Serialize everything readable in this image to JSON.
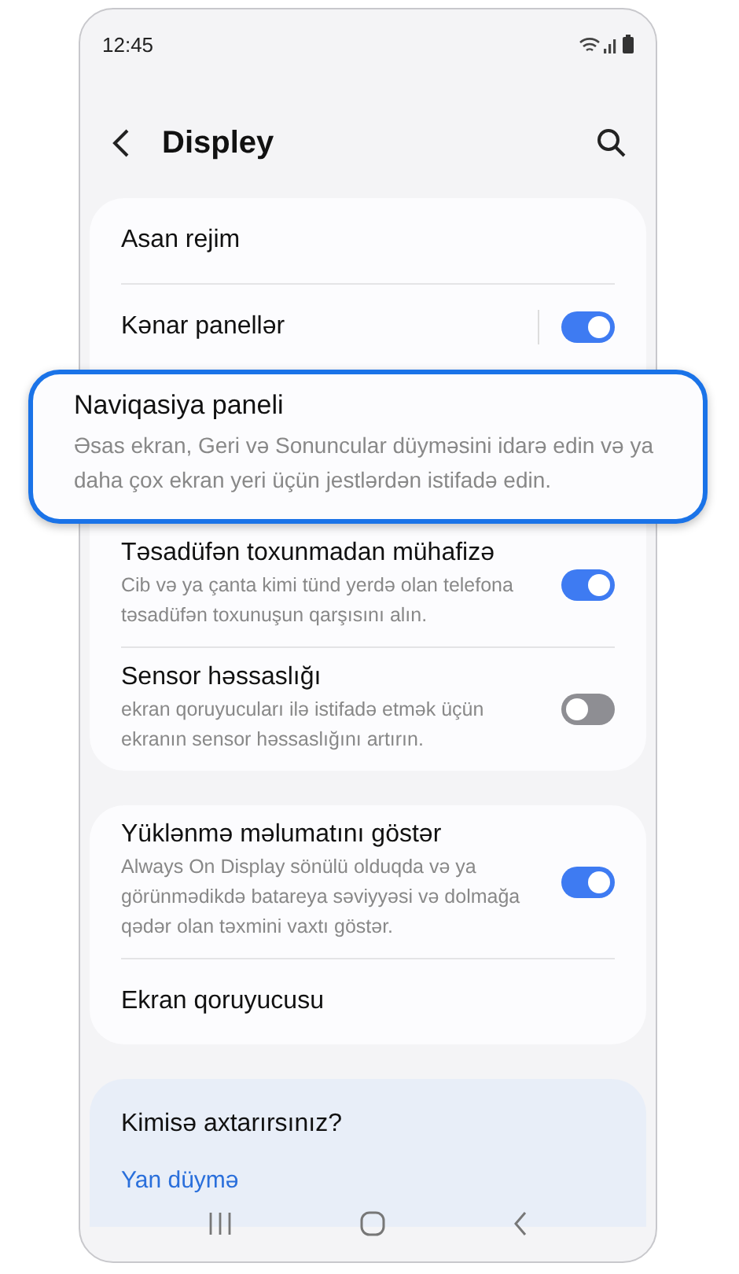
{
  "status_bar": {
    "time": "12:45"
  },
  "header": {
    "title": "Displey"
  },
  "groups": [
    {
      "items": [
        {
          "kind": "plain",
          "title": "Asan rejim"
        },
        {
          "kind": "toggle",
          "title": "Kənar panellər",
          "on": true,
          "divider": true
        },
        {
          "kind": "highlight",
          "title": "Naviqasiya paneli",
          "subtitle": "Əsas ekran, Geri və Sonuncular düyməsini idarə edin və ya daha çox ekran yeri üçün jestlərdən istifadə edin."
        },
        {
          "kind": "toggle",
          "title": "Təsadüfən toxunmadan mühafizə",
          "subtitle": "Cib və ya çanta kimi tünd yerdə olan telefona təsadüfən toxunuşun qarşısını alın.",
          "on": true
        },
        {
          "kind": "toggle",
          "title": "Sensor həssaslığı",
          "subtitle": "ekran qoruyucuları ilə istifadə etmək üçün ekranın sensor həssaslığını artırın.",
          "on": false
        }
      ]
    },
    {
      "items": [
        {
          "kind": "toggle",
          "title": "Yüklənmə məlumatını göstər",
          "subtitle": "Always On Display sönülü olduqda və ya görünmədikdə batareya səviyyəsi və dolmağa qədər olan təxmini vaxtı göstər.",
          "on": true
        },
        {
          "kind": "plain",
          "title": "Ekran qoruyucusu"
        }
      ]
    }
  ],
  "suggestions": {
    "title": "Kimisə axtarırsınız?",
    "link": "Yan düymə"
  }
}
